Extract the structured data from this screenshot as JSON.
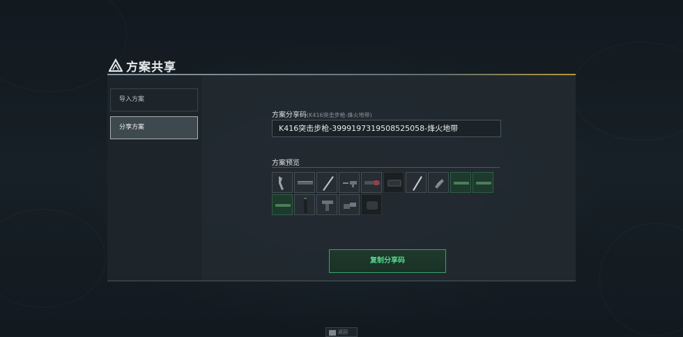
{
  "window": {
    "title": "方案共享"
  },
  "sidebar": {
    "items": [
      {
        "label": "导入方案",
        "active": false
      },
      {
        "label": "分享方案",
        "active": true
      }
    ]
  },
  "share": {
    "code_label": "方案分享码",
    "code_sublabel": "(K416突击步枪-烽火地带)",
    "code_value": "K416突击步枪-3999197319508525058-烽火地带",
    "preview_label": "方案预览",
    "copy_button": "复制分享码"
  },
  "preview_slots": [
    {
      "icon": "stock-icon",
      "style": "normal"
    },
    {
      "icon": "rail-icon",
      "style": "normal"
    },
    {
      "icon": "barrel-icon",
      "style": "normal"
    },
    {
      "icon": "scope-mount-icon",
      "style": "normal"
    },
    {
      "icon": "handguard-icon",
      "style": "normal"
    },
    {
      "icon": "receiver-icon",
      "style": "dark"
    },
    {
      "icon": "long-barrel-icon",
      "style": "normal"
    },
    {
      "icon": "suppressor-icon",
      "style": "normal"
    },
    {
      "icon": "rail-cover-icon",
      "style": "green"
    },
    {
      "icon": "rail-cover-icon",
      "style": "green"
    },
    {
      "icon": "rail-cover-icon",
      "style": "green"
    },
    {
      "icon": "magazine-icon",
      "style": "normal"
    },
    {
      "icon": "grip-icon",
      "style": "normal"
    },
    {
      "icon": "optic-icon",
      "style": "normal"
    },
    {
      "icon": "muzzle-icon",
      "style": "dark"
    }
  ],
  "footer": {
    "hint": "返回"
  },
  "colors": {
    "accent_green": "#3aa56b",
    "accent_text_green": "#55d68d",
    "accent_gold": "#b59a3a"
  }
}
